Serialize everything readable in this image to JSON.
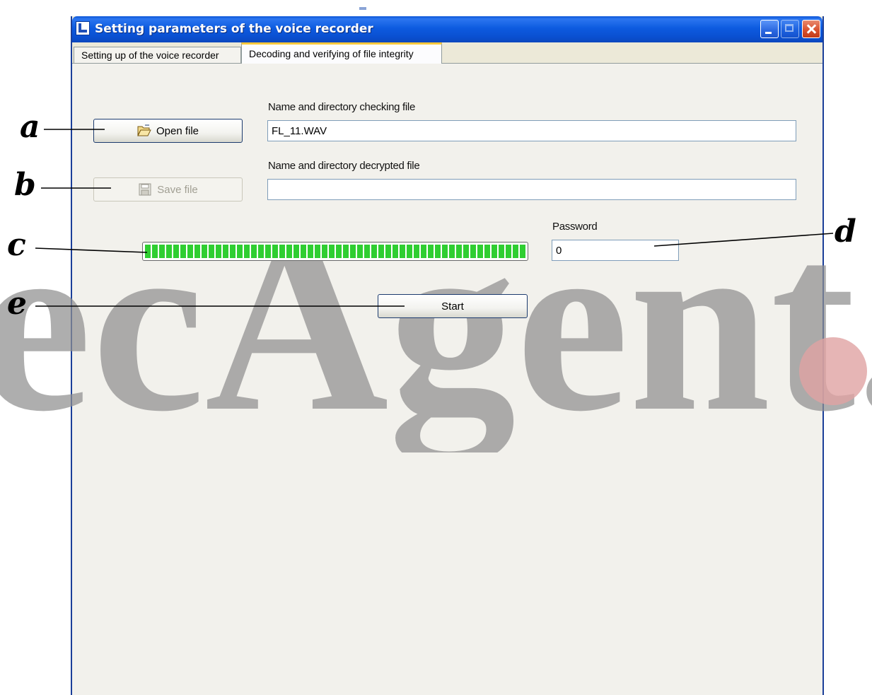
{
  "window": {
    "title": "Setting parameters of the voice recorder",
    "controls": [
      "minimize",
      "maximize",
      "close"
    ]
  },
  "tabs": [
    {
      "label": "Setting up of the voice recorder",
      "active": false
    },
    {
      "label": "Decoding and verifying of file integrity",
      "active": true
    }
  ],
  "form": {
    "open_button_label": "Open file",
    "open_button_icon": "folder-open-icon",
    "save_button_label": "Save file",
    "save_button_icon": "floppy-disk-icon",
    "save_button_enabled": false,
    "check_file_label": "Name and directory checking file",
    "check_file_value": "FL_11.WAV",
    "decrypted_file_label": "Name and directory decrypted file",
    "decrypted_file_value": "",
    "password_label": "Password",
    "password_value": "0",
    "start_button_label": "Start"
  },
  "progress": {
    "value_percent": 100,
    "color": "#2fce31"
  },
  "callouts": {
    "a": "a",
    "b": "b",
    "c": "c",
    "d": "d",
    "e": "e"
  },
  "watermark": {
    "text": "ecAgent.",
    "color": "#8f8f8f",
    "dot_color": "#e0a3a3"
  },
  "colors": {
    "titlebar": "#0a53d6",
    "tab_highlight": "#ffc83c",
    "dialog_background": "#ece9d8"
  }
}
